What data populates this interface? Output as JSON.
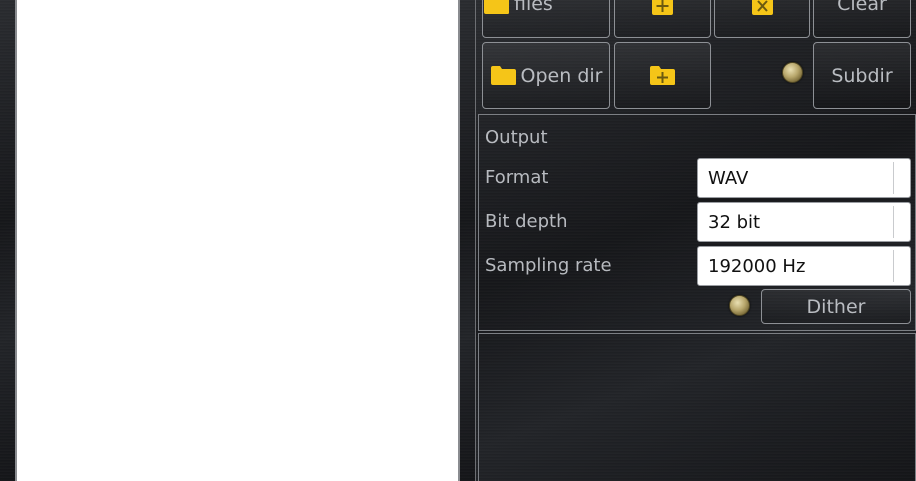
{
  "toolbar_row1": {
    "open_files_label": "Open files",
    "add_icon": "plus-icon",
    "remove_icon": "x-icon",
    "clear_label": "Clear"
  },
  "toolbar_row2": {
    "open_dir_label": "Open dir",
    "add_dir_icon": "folder-plus-icon",
    "subdir_label": "Subdir"
  },
  "output": {
    "heading": "Output",
    "format_label": "Format",
    "format_value": "WAV",
    "bit_depth_label": "Bit depth",
    "bit_depth_value": "32 bit",
    "sampling_rate_label": "Sampling rate",
    "sampling_rate_value": "192000 Hz",
    "dither_label": "Dither"
  },
  "colors": {
    "accent_yellow": "#f5c518",
    "led_gold": "#b7a66b",
    "panel_dark": "#1a1b1d",
    "border": "#8d9095"
  }
}
